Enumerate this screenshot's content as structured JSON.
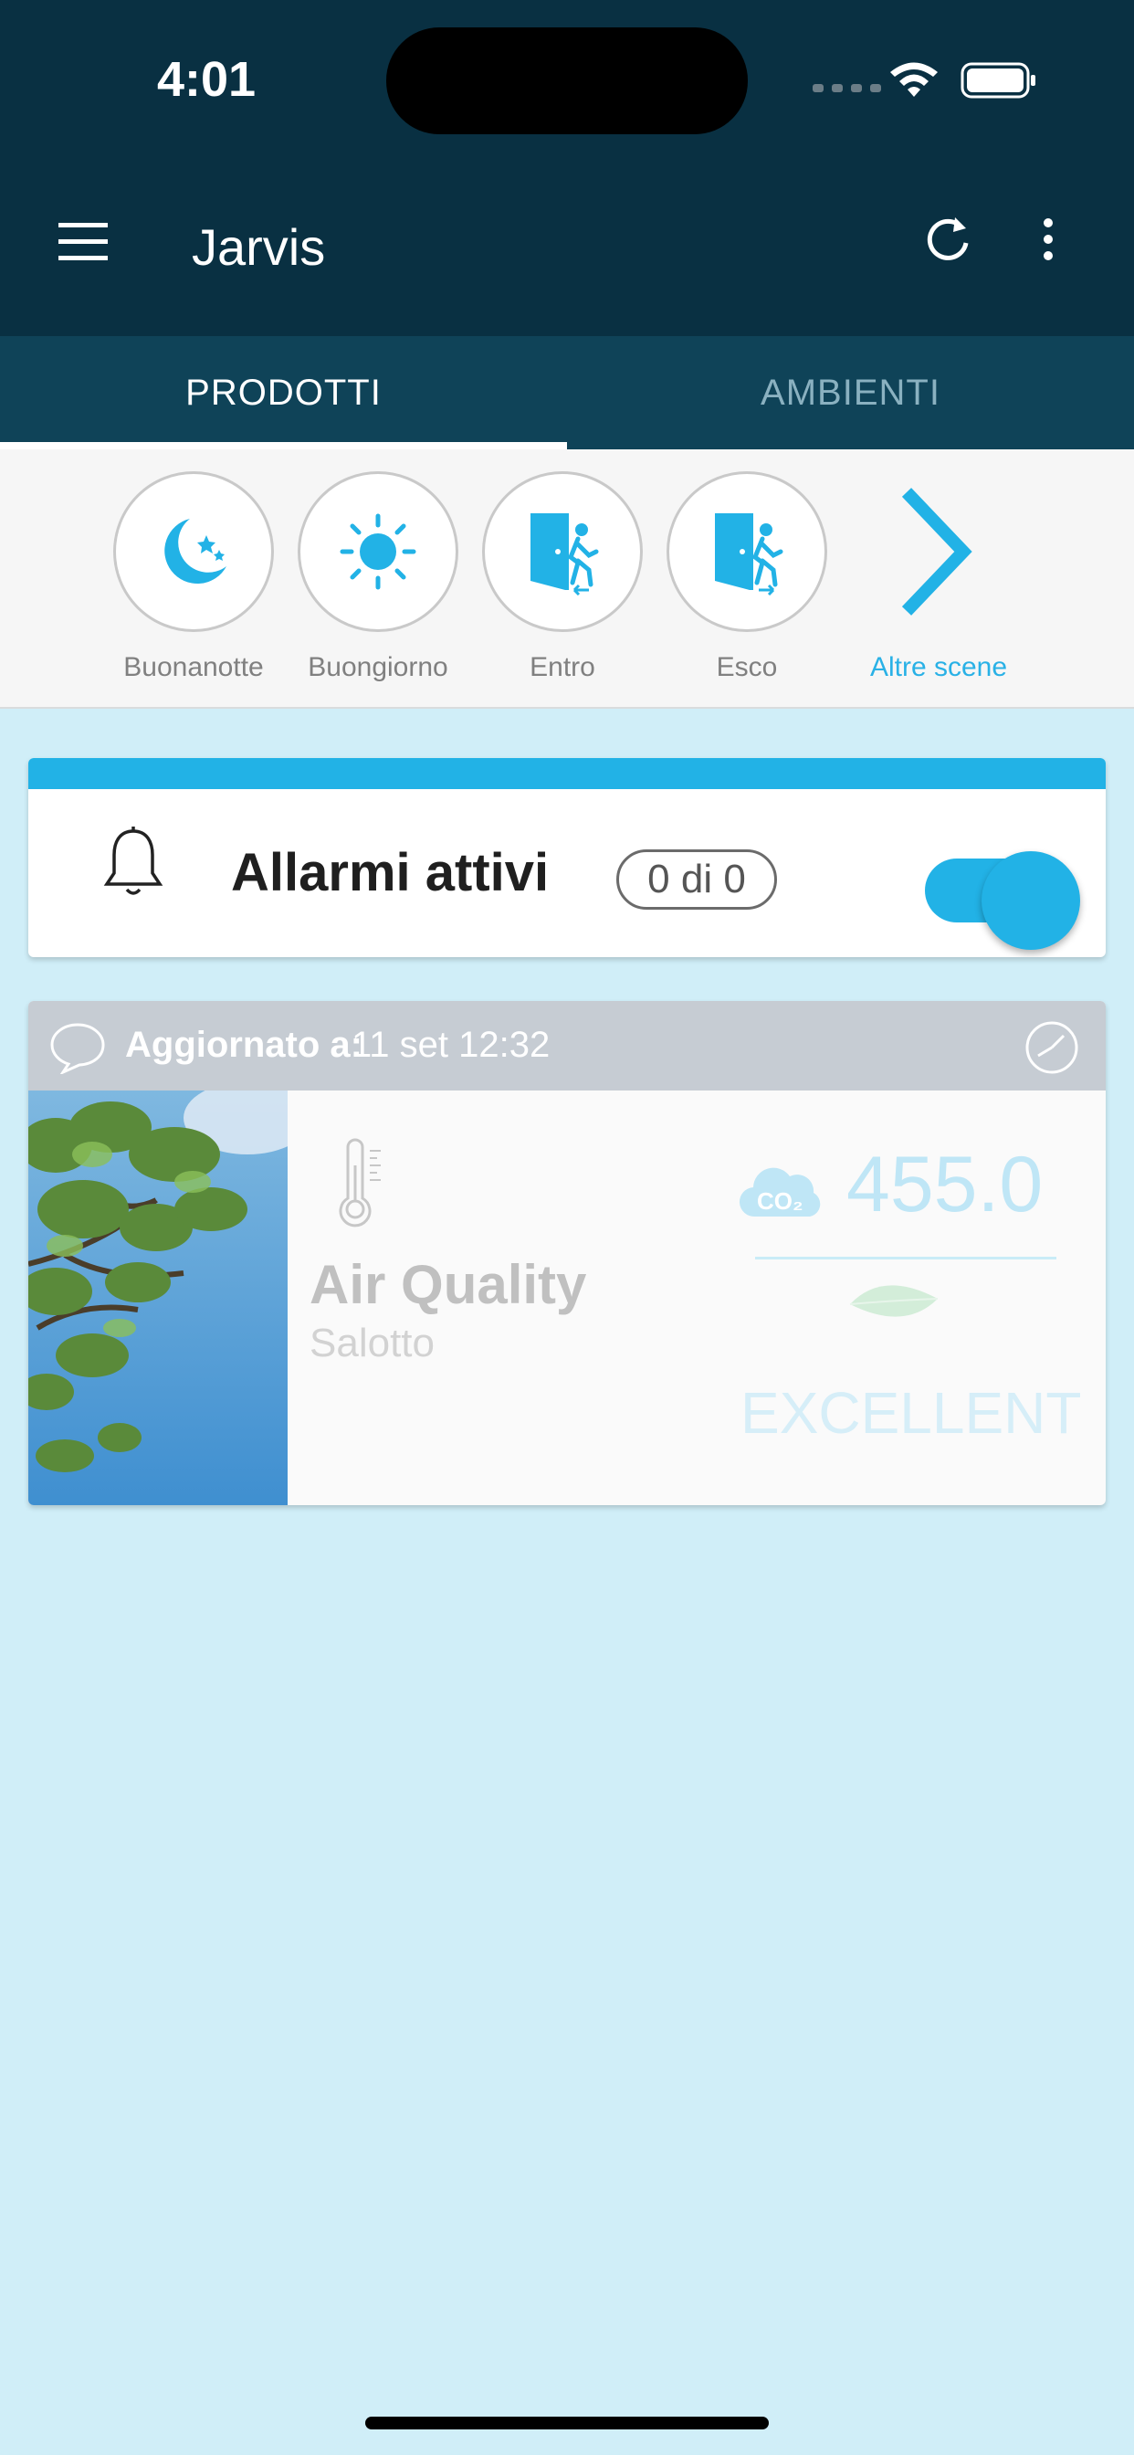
{
  "status_bar": {
    "time": "4:01"
  },
  "app_bar": {
    "title": "Jarvis"
  },
  "tabs": [
    {
      "label": "PRODOTTI"
    },
    {
      "label": "AMBIENTI"
    }
  ],
  "scenes": [
    {
      "label": "Buonanotte",
      "icon": "moon-stars-icon"
    },
    {
      "label": "Buongiorno",
      "icon": "sun-icon"
    },
    {
      "label": "Entro",
      "icon": "door-enter-icon"
    },
    {
      "label": "Esco",
      "icon": "door-exit-icon"
    },
    {
      "label": "Altre scene",
      "icon": "chevron-right-icon"
    }
  ],
  "alarms": {
    "title": "Allarmi attivi",
    "count": "0 di 0",
    "toggle_on": true
  },
  "air_quality": {
    "updated_label": "Aggiornato a:",
    "updated_value": "11 set 12:32",
    "name": "Air Quality",
    "room": "Salotto",
    "co2_label": "CO₂",
    "value": "455.0",
    "status": "EXCELLENT"
  },
  "colors": {
    "accent": "#22b2e6",
    "header_bg": "#093042",
    "tabs_bg": "#0f4358",
    "page_bg": "#d0eef8"
  }
}
